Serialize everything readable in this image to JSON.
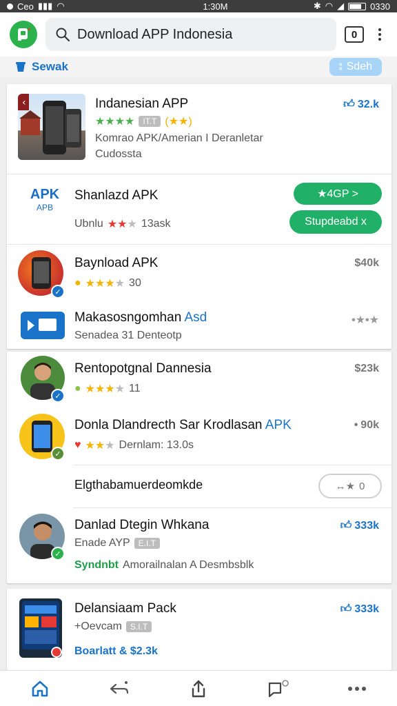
{
  "status_bar": {
    "carrier": "Ceo",
    "time": "1:30M",
    "battery_text": "0330"
  },
  "search": {
    "query": "Download APP Indonesia",
    "tab_count": "0"
  },
  "filter_bar": {
    "sort_label": "Sewak",
    "filter_label": "Sdeh"
  },
  "apps": [
    {
      "title": "Indanesian APP",
      "rating_tag": "IT.T",
      "meta_line1": "Komrao APK/Amerian I Deranletar",
      "meta_line2": "Cudossta",
      "price": "32.k"
    },
    {
      "title": "Shanlazd APK",
      "logo_text": "APK",
      "logo_sub": "APB",
      "meta": "Ubnlu",
      "meta_count": "13ask",
      "install_label": "★4GP >",
      "update_label": "Stupdeabd x"
    },
    {
      "title": "Baynload APK",
      "rating_count": "30",
      "price": "$40k"
    },
    {
      "title": "Makasosngomhan",
      "title_suffix": "Asd",
      "meta": "Senadea 31 Denteotp"
    },
    {
      "title": "Rentopotgnal Dannesia",
      "rating_count": "11",
      "price": "$23k"
    },
    {
      "title": "Donla Dlandrecth Sar Krodlasan",
      "title_suffix": "APK",
      "meta": "Dernlam: 13.0s",
      "price": "90k"
    },
    {
      "title": "Elgthabamuerdeomkde",
      "action_label": "0"
    },
    {
      "title": "Danlad Dtegin Whkana",
      "sub1": "Enade AYP",
      "sub1_tag": "E.I.T",
      "sub2_prefix": "Syndnbt",
      "sub2": "Amorailnalan A Desmbsblk",
      "price": "333k"
    },
    {
      "title": "Delansiaam Pack",
      "sub1": "+Oevcam",
      "sub1_tag": "S.I.T",
      "sub2": "Boarlatt & $2.3k",
      "price": "333k"
    }
  ]
}
